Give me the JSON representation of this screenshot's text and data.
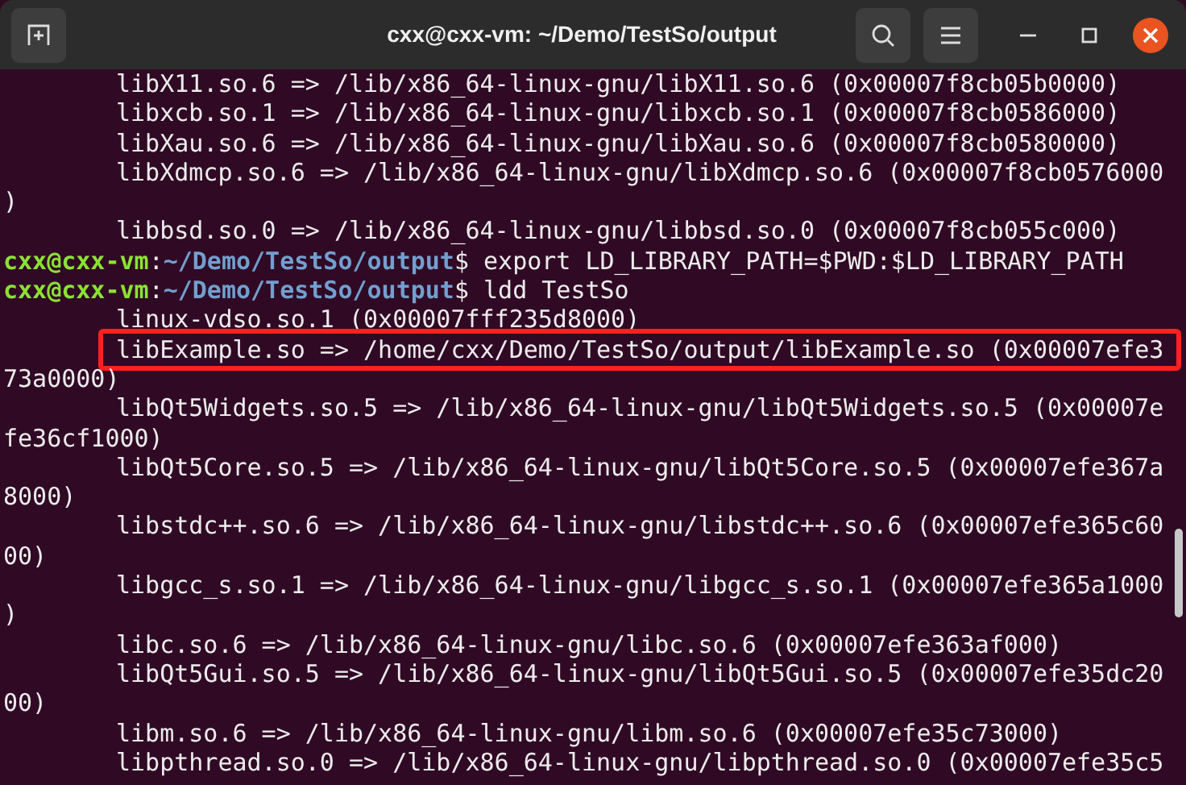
{
  "window": {
    "title": "cxx@cxx-vm: ~/Demo/TestSo/output"
  },
  "terminal_rows": [
    {
      "kind": "entry",
      "highlighted": false,
      "text": "libX11.so.6 => /lib/x86_64-linux-gnu/libX11.so.6 (0x00007f8cb05b0000)"
    },
    {
      "kind": "entry",
      "highlighted": false,
      "text": "libxcb.so.1 => /lib/x86_64-linux-gnu/libxcb.so.1 (0x00007f8cb0586000)"
    },
    {
      "kind": "entry",
      "highlighted": false,
      "text": "libXau.so.6 => /lib/x86_64-linux-gnu/libXau.so.6 (0x00007f8cb0580000)"
    },
    {
      "kind": "entry",
      "highlighted": false,
      "text": "libXdmcp.so.6 => /lib/x86_64-linux-gnu/libXdmcp.so.6 (0x00007f8cb0576000"
    },
    {
      "kind": "continuation",
      "text": ")"
    },
    {
      "kind": "entry",
      "highlighted": false,
      "text": "libbsd.so.0 => /lib/x86_64-linux-gnu/libbsd.so.0 (0x00007f8cb055c000)"
    },
    {
      "kind": "prompt",
      "user": "cxx@cxx-vm",
      "separator": ":",
      "path": "~/Demo/TestSo/output",
      "command": "$ export LD_LIBRARY_PATH=$PWD:$LD_LIBRARY_PATH"
    },
    {
      "kind": "prompt",
      "user": "cxx@cxx-vm",
      "separator": ":",
      "path": "~/Demo/TestSo/output",
      "command": "$ ldd TestSo"
    },
    {
      "kind": "entry",
      "highlighted": false,
      "text": "linux-vdso.so.1 (0x00007fff235d8000)"
    },
    {
      "kind": "entry",
      "highlighted": true,
      "text": "libExample.so => /home/cxx/Demo/TestSo/output/libExample.so (0x00007efe3"
    },
    {
      "kind": "continuation",
      "text": "73a0000)"
    },
    {
      "kind": "entry",
      "highlighted": false,
      "text": "libQt5Widgets.so.5 => /lib/x86_64-linux-gnu/libQt5Widgets.so.5 (0x00007e"
    },
    {
      "kind": "continuation",
      "text": "fe36cf1000)"
    },
    {
      "kind": "entry",
      "highlighted": false,
      "text": "libQt5Core.so.5 => /lib/x86_64-linux-gnu/libQt5Core.so.5 (0x00007efe367a"
    },
    {
      "kind": "continuation",
      "text": "8000)"
    },
    {
      "kind": "entry",
      "highlighted": false,
      "text": "libstdc++.so.6 => /lib/x86_64-linux-gnu/libstdc++.so.6 (0x00007efe365c60"
    },
    {
      "kind": "continuation",
      "text": "00)"
    },
    {
      "kind": "entry",
      "highlighted": false,
      "text": "libgcc_s.so.1 => /lib/x86_64-linux-gnu/libgcc_s.so.1 (0x00007efe365a1000"
    },
    {
      "kind": "continuation",
      "text": ")"
    },
    {
      "kind": "entry",
      "highlighted": false,
      "text": "libc.so.6 => /lib/x86_64-linux-gnu/libc.so.6 (0x00007efe363af000)"
    },
    {
      "kind": "entry",
      "highlighted": false,
      "text": "libQt5Gui.so.5 => /lib/x86_64-linux-gnu/libQt5Gui.so.5 (0x00007efe35dc20"
    },
    {
      "kind": "continuation",
      "text": "00)"
    },
    {
      "kind": "entry",
      "highlighted": false,
      "text": "libm.so.6 => /lib/x86_64-linux-gnu/libm.so.6 (0x00007efe35c73000)"
    },
    {
      "kind": "entry",
      "highlighted": false,
      "text": "libpthread.so.0 => /lib/x86_64-linux-gnu/libpthread.so.0 (0x00007efe35c5"
    }
  ]
}
